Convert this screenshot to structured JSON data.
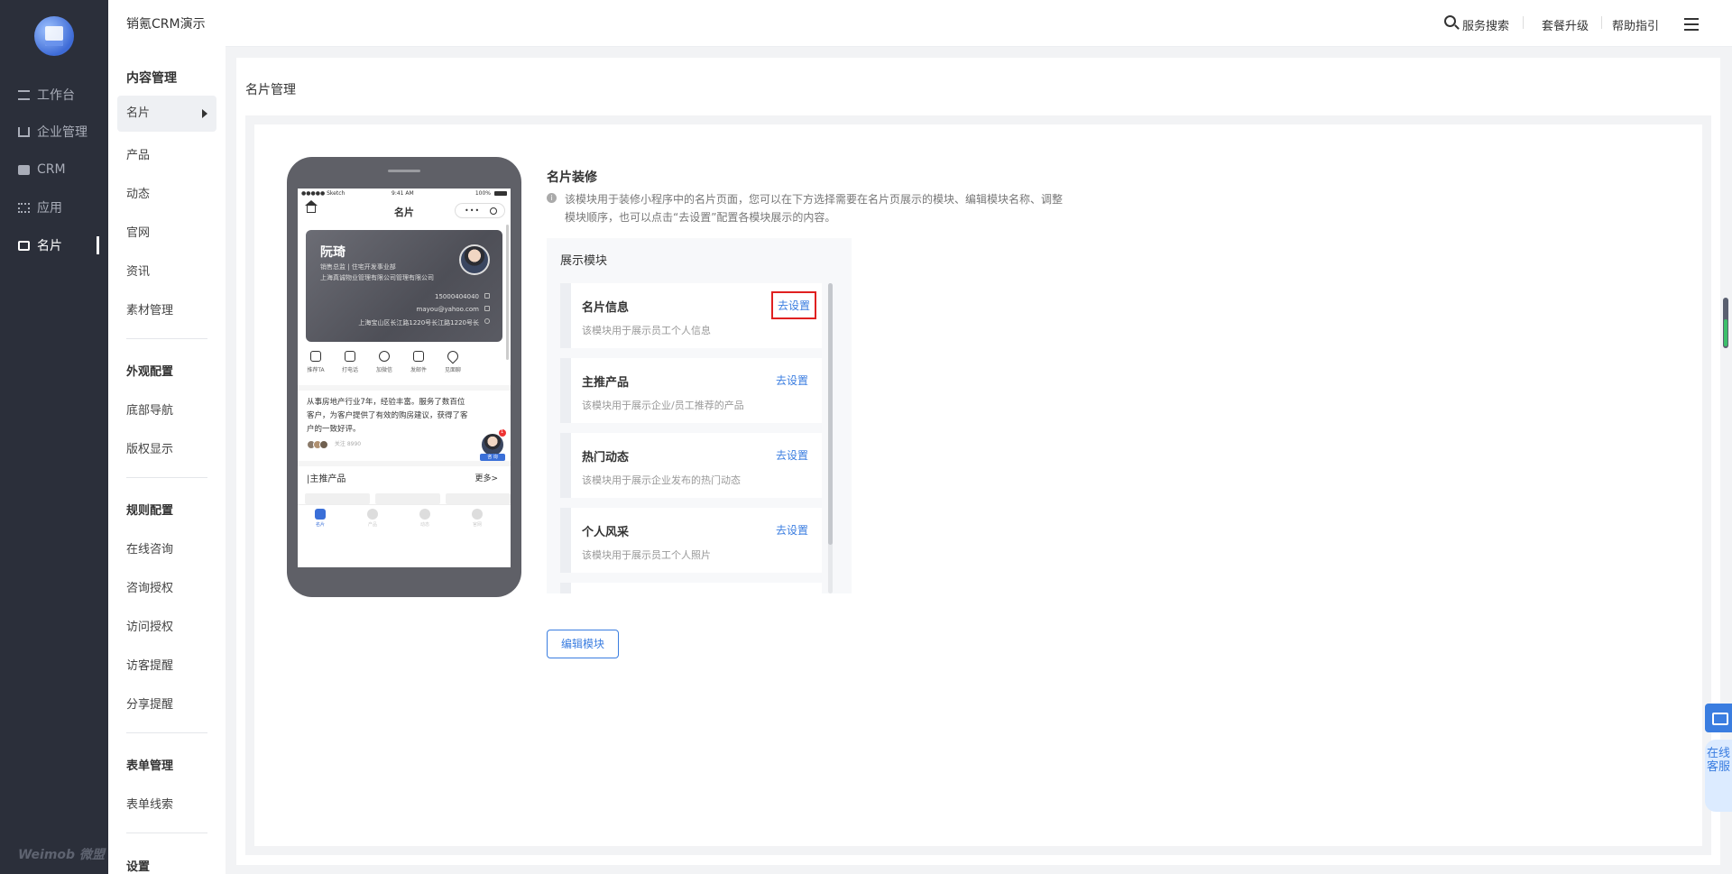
{
  "nav": {
    "items": [
      {
        "label": "工作台",
        "icon": "workbench-icon"
      },
      {
        "label": "企业管理",
        "icon": "org-icon"
      },
      {
        "label": "CRM",
        "icon": "crm-icon"
      },
      {
        "label": "应用",
        "icon": "apps-icon"
      },
      {
        "label": "名片",
        "icon": "card-icon",
        "active": true
      }
    ],
    "brand": "Weimob 微盟"
  },
  "submenu": {
    "title": "内容管理",
    "items": [
      "名片",
      "产品",
      "动态",
      "官网",
      "资讯",
      "素材管理"
    ],
    "groups": [
      {
        "title": "外观配置",
        "items": [
          "底部导航",
          "版权显示"
        ]
      },
      {
        "title": "规则配置",
        "items": [
          "在线咨询",
          "咨询授权",
          "访问授权",
          "访客提醒",
          "分享提醒"
        ]
      },
      {
        "title": "表单管理",
        "items": [
          "表单线索"
        ]
      },
      {
        "title": "设置",
        "items": []
      }
    ]
  },
  "topbar": {
    "app_title": "销氪CRM演示",
    "search": "服务搜索",
    "upgrade": "套餐升级",
    "help": "帮助指引"
  },
  "main": {
    "title": "名片管理",
    "section_title": "名片装修",
    "description": "该模块用于装修小程序中的名片页面，您可以在下方选择需要在名片页展示的模块、编辑模块名称、调整模块顺序，也可以点击“去设置”配置各模块展示的内容。",
    "module_box_title": "展示模块",
    "modules": [
      {
        "name": "名片信息",
        "desc": "该模块用于展示员工个人信息",
        "link": "去设置"
      },
      {
        "name": "主推产品",
        "desc": "该模块用于展示企业/员工推荐的产品",
        "link": "去设置"
      },
      {
        "name": "热门动态",
        "desc": "该模块用于展示企业发布的热门动态",
        "link": "去设置"
      },
      {
        "name": "个人风采",
        "desc": "该模块用于展示员工个人照片",
        "link": "去设置"
      }
    ],
    "edit_button": "编辑模块"
  },
  "phone": {
    "status_left": "●●●●● Sketch",
    "status_time": "9:41 AM",
    "status_right": "100%",
    "page_title": "名片",
    "capsule_dots": "•••",
    "card": {
      "name": "阮琦",
      "role": "销售总监 | 住宅开发事业部",
      "company": "上海真诚物业管理有限公司管理有限公司",
      "phone": "15000404040",
      "email": "mayou@yahoo.com",
      "address": "上海宝山区长江路1220号长江路1220号长"
    },
    "actions": [
      "推荐TA",
      "打电话",
      "加微信",
      "发邮件",
      "见面聊"
    ],
    "bio": "从事房地产行业7年，经验丰富。服务了数百位客户，为客户提供了有效的购房建议，获得了客户的一致好评。",
    "likes": "关注 8990",
    "float_badge": "1",
    "float_tag": "咨 询",
    "section_title": "|主推产品",
    "section_more": "更多>",
    "tabs": [
      "名片",
      "产品",
      "动态",
      "官网"
    ]
  },
  "widgets": {
    "online_service": "在线客服"
  }
}
